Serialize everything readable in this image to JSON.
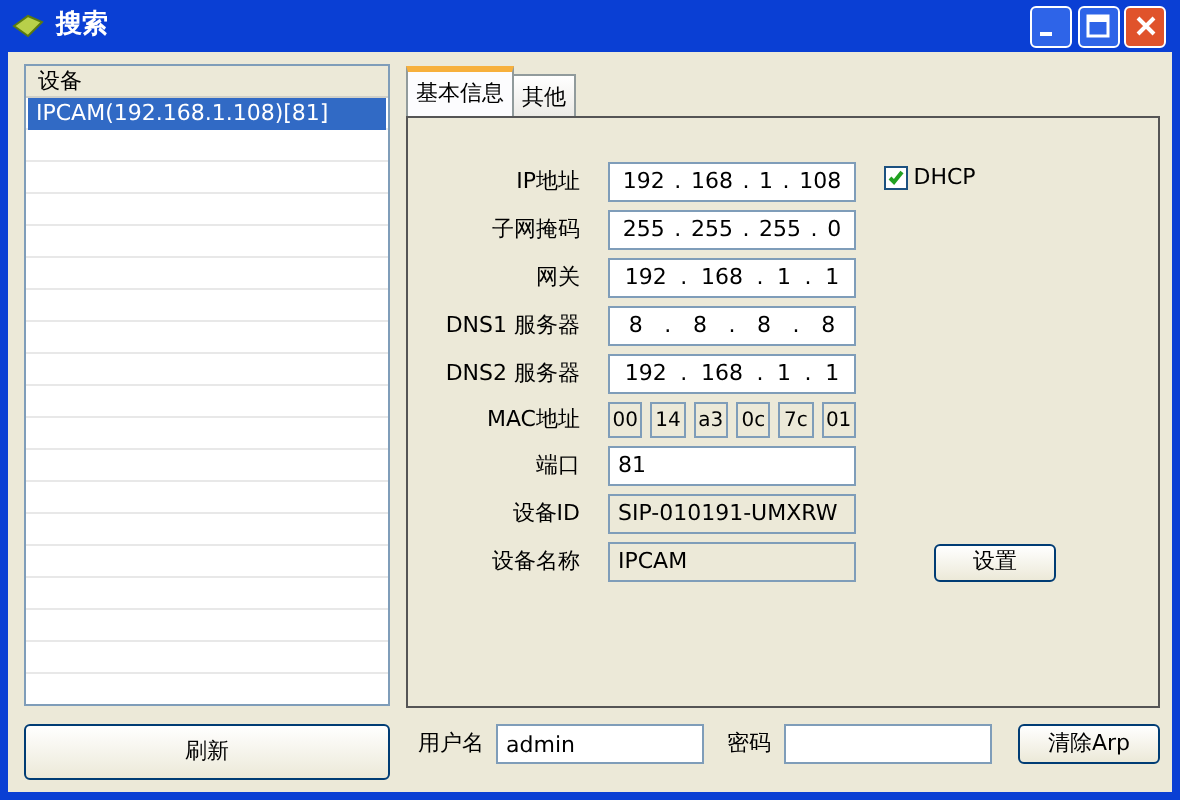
{
  "window": {
    "title": "搜索"
  },
  "device_list": {
    "header": "设备",
    "rows": [
      {
        "label": "IPCAM(192.168.1.108)[81]",
        "selected": true
      }
    ]
  },
  "refresh_button": "刷新",
  "tabs": [
    {
      "label": "基本信息",
      "selected": true
    },
    {
      "label": "其他",
      "selected": false
    }
  ],
  "fields": [
    {
      "kind": "ip",
      "label": "IP地址",
      "separator": ".",
      "octets": [
        "192",
        "168",
        "1",
        "108"
      ]
    },
    {
      "kind": "ip",
      "label": "子网掩码",
      "separator": ".",
      "octets": [
        "255",
        "255",
        "255",
        "0"
      ]
    },
    {
      "kind": "ip",
      "label": "网关",
      "separator": ".",
      "octets": [
        "192",
        "168",
        "1",
        "1"
      ]
    },
    {
      "kind": "ip",
      "label": "DNS1 服务器",
      "separator": ".",
      "octets": [
        "8",
        "8",
        "8",
        "8"
      ]
    },
    {
      "kind": "ip",
      "label": "DNS2 服务器",
      "separator": ".",
      "octets": [
        "192",
        "168",
        "1",
        "1"
      ]
    },
    {
      "kind": "mac",
      "label": "MAC地址",
      "bytes": [
        "00",
        "14",
        "a3",
        "0c",
        "7c",
        "01"
      ]
    },
    {
      "kind": "text",
      "label": "端口",
      "value": "81",
      "readonly": false
    },
    {
      "kind": "text",
      "label": "设备ID",
      "value": "SIP-010191-UMXRW",
      "readonly": true
    },
    {
      "kind": "text",
      "label": "设备名称",
      "value": "IPCAM",
      "readonly": true
    }
  ],
  "dhcp": {
    "label": "DHCP",
    "checked": true
  },
  "set_button": "设置",
  "login": {
    "username_label": "用户名",
    "username": "admin",
    "password_label": "密码"
  },
  "clear_arp_button": "清除Arp"
}
